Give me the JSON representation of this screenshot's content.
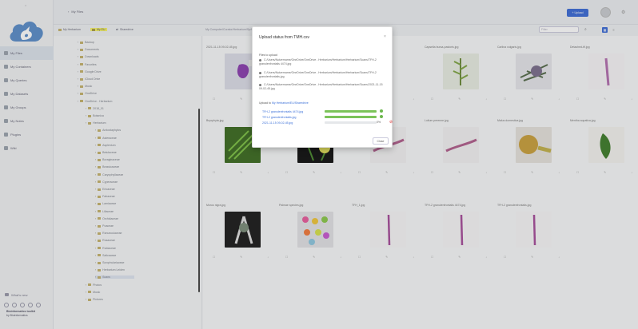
{
  "sidebar": {
    "top_icon": "chevron-up-icon",
    "nav": [
      {
        "label": "My Files",
        "icon": "folder-icon",
        "active": true
      },
      {
        "label": "My Containers",
        "icon": "container-icon"
      },
      {
        "label": "My Queries",
        "icon": "query-icon"
      },
      {
        "label": "My Datasets",
        "icon": "dataset-icon"
      },
      {
        "label": "My Groups",
        "icon": "group-icon"
      },
      {
        "label": "My Notes",
        "icon": "note-icon"
      },
      {
        "label": "Plugins",
        "icon": "plugin-icon"
      },
      {
        "label": "Wiki",
        "icon": "wiki-icon"
      }
    ],
    "whats_new": "What's new",
    "footer_line1": "Bioinformatics toolkit",
    "footer_line2": "by Bioinformatics"
  },
  "topbar": {
    "crumb_icon": "chevron-left-icon",
    "breadcrumb": "My Files",
    "upload_label": "+ Upload",
    "gear_icon": "gear-icon"
  },
  "filterbar": {
    "tabs": [
      "My Herbarium",
      "My EU",
      "Sharedrive"
    ],
    "path": "My Computer/Curator/Herbarium/Sp/Herbarium/Sp.../Herbarium/.../Herbarium",
    "search_placeholder": "Filter"
  },
  "tree": {
    "rows": [
      "Backup",
      "Documents",
      "Downloads",
      "Favorites",
      "Google Drive",
      "iCloud Drive",
      "Music",
      "OneDrive",
      "OneDrive - Herbarium",
      "2018_01",
      "Botanica",
      "Herbarium",
      "Arctostaphylos",
      "Asteraceae",
      "Asplenium",
      "Betulaceae",
      "Boraginaceae",
      "Brassicaceae",
      "Caryophyllaceae",
      "Cyperaceae",
      "Ericaceae",
      "Fabaceae",
      "Lamiaceae",
      "Liliaceae",
      "Orchidaceae",
      "Poaceae",
      "Ranunculaceae",
      "Rosaceae",
      "Rubiaceae",
      "Salicaceae",
      "Scrophulariaceae",
      "Herbarium Leiden",
      "Scans",
      "Photos",
      "Music",
      "Pictures"
    ],
    "selected_index": 32
  },
  "grid": {
    "cards": [
      {
        "name": "2021-11-15 09-02-45.jpg",
        "thumb": "purple"
      },
      {
        "name": "",
        "thumb": "none"
      },
      {
        "name": "",
        "thumb": "none"
      },
      {
        "name": "Capsella bursa-pastoris.jpg",
        "thumb": "plant"
      },
      {
        "name": "Carlina vulgaris.jpg",
        "thumb": "thistle"
      },
      {
        "name": "Detached-tif.jpg",
        "thumb": "stem"
      },
      {
        "name": "Bryophyta.jpg",
        "thumb": "fern"
      },
      {
        "name": "",
        "thumb": "flowers"
      },
      {
        "name": "",
        "thumb": "stem-diag"
      },
      {
        "name": "Lolium perenne.jpg",
        "thumb": "stem-diag"
      },
      {
        "name": "Malus domestica.jpg",
        "thumb": "fruit"
      },
      {
        "name": "Mentha aquatica.jpg",
        "thumb": "leaf"
      },
      {
        "name": "Morus nigra.jpg",
        "thumb": "bw"
      },
      {
        "name": "Palmae species.jpg",
        "thumb": "colorful"
      },
      {
        "name": "TFH_1.jpg",
        "thumb": "thin"
      },
      {
        "name": "TFH-2 granulenfrontalis 4474.jpg",
        "thumb": "thin"
      },
      {
        "name": "TFH-2 granulenfrontalis.jpg",
        "thumb": "thin"
      }
    ]
  },
  "dialog": {
    "title": "Upload status from TMH.csv",
    "close_icon": "close-icon",
    "files_header": "Files to upload",
    "files": [
      "C:/Users/Nutzername/OneDrive/OneDrive - Herbarium/Herbarium/Herbarium/Scans/TFH-2 granulenfrontalis 4474.jpg",
      "C:/Users/Nutzername/OneDrive/OneDrive - Herbarium/Herbarium/Herbarium/Scans/TFH-2 granulenfrontalis.jpg",
      "C:/Users/Nutzername/OneDrive/OneDrive - Herbarium/Herbarium/Herbarium/Scans/2021-11-15 09-02-45.jpg"
    ],
    "upload_to_prefix": "Upload to",
    "upload_to_path": "My Herbarium/EU/Sharedrive",
    "progress": [
      {
        "file": "TFH-2 granulenfrontalis 4474.jpg",
        "fraction": 1.0,
        "status": "done"
      },
      {
        "file": "TFH-2 granulenfrontalis.jpg",
        "fraction": 1.0,
        "status": "done"
      },
      {
        "file": "2021-11-15 09-02-45.jpg",
        "fraction": 0.0,
        "status": "pending",
        "percent": "0%"
      }
    ],
    "close_label": "Close",
    "colors": {
      "progress": "#7cc35a",
      "link": "#3a6fd8",
      "cancel": "#dd3333"
    }
  }
}
